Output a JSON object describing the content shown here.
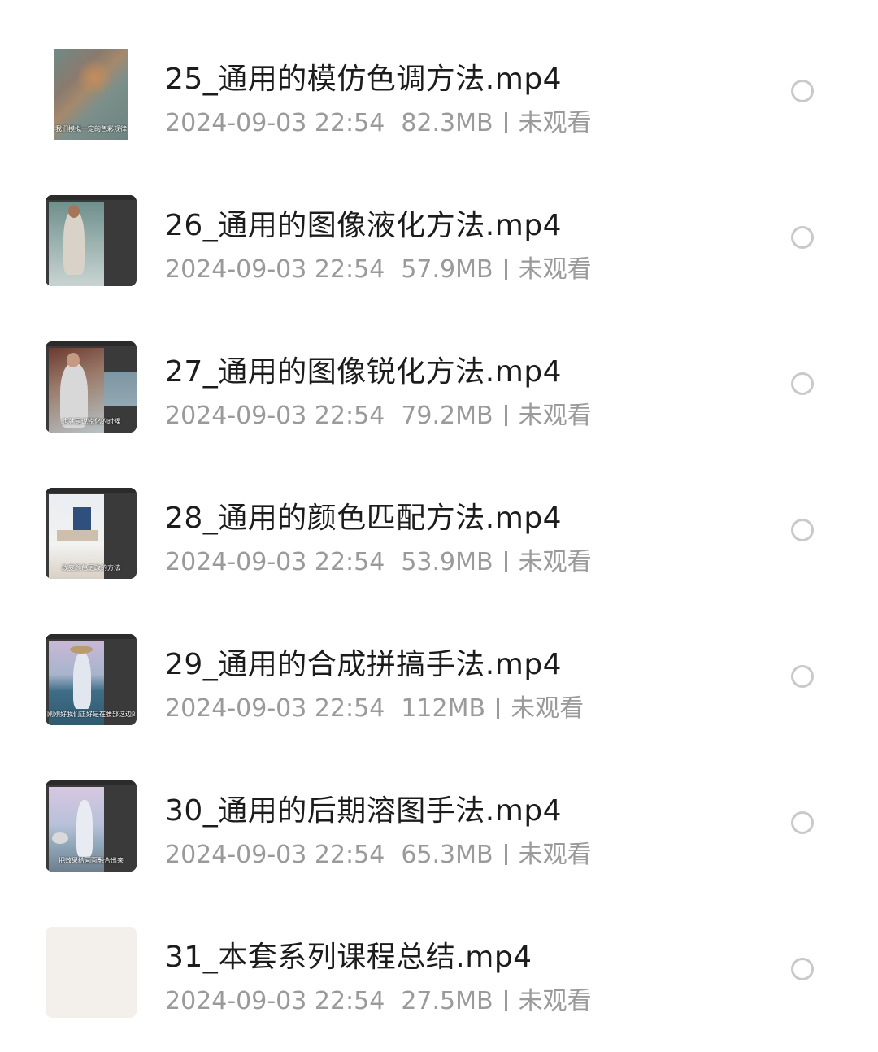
{
  "colors": {
    "title": "#1c1c1c",
    "meta": "#9a9a9a",
    "radio_border": "#c9c9c9",
    "background": "#ffffff"
  },
  "files": [
    {
      "title": "25_通用的模仿色调方法.mp4",
      "date": "2024-09-03 22:54",
      "size": "82.3MB",
      "status": "未观看",
      "thumb_caption": "我们模拟一定的色彩规律",
      "thumb_icon": "video-thumbnail-icon"
    },
    {
      "title": "26_通用的图像液化方法.mp4",
      "date": "2024-09-03 22:54",
      "size": "57.9MB",
      "status": "未观看",
      "thumb_caption": "",
      "thumb_icon": "video-thumbnail-icon"
    },
    {
      "title": "27_通用的图像锐化方法.mp4",
      "date": "2024-09-03 22:54",
      "size": "79.2MB",
      "status": "未观看",
      "thumb_caption": "也就是说锐化的时候",
      "thumb_icon": "video-thumbnail-icon"
    },
    {
      "title": "28_通用的颜色匹配方法.mp4",
      "date": "2024-09-03 22:54",
      "size": "53.9MB",
      "status": "未观看",
      "thumb_caption": "改变颜色更改的方法",
      "thumb_icon": "video-thumbnail-icon"
    },
    {
      "title": "29_通用的合成拼搞手法.mp4",
      "date": "2024-09-03 22:54",
      "size": "112MB",
      "status": "未观看",
      "thumb_caption": "刚刚好我们正好是在腰部这边的",
      "thumb_icon": "video-thumbnail-icon"
    },
    {
      "title": "30_通用的后期溶图手法.mp4",
      "date": "2024-09-03 22:54",
      "size": "65.3MB",
      "status": "未观看",
      "thumb_caption": "把效果给画面融合出来",
      "thumb_icon": "video-thumbnail-icon"
    },
    {
      "title": "31_本套系列课程总结.mp4",
      "date": "2024-09-03 22:54",
      "size": "27.5MB",
      "status": "未观看",
      "thumb_caption": "",
      "thumb_icon": "video-thumbnail-icon"
    }
  ]
}
